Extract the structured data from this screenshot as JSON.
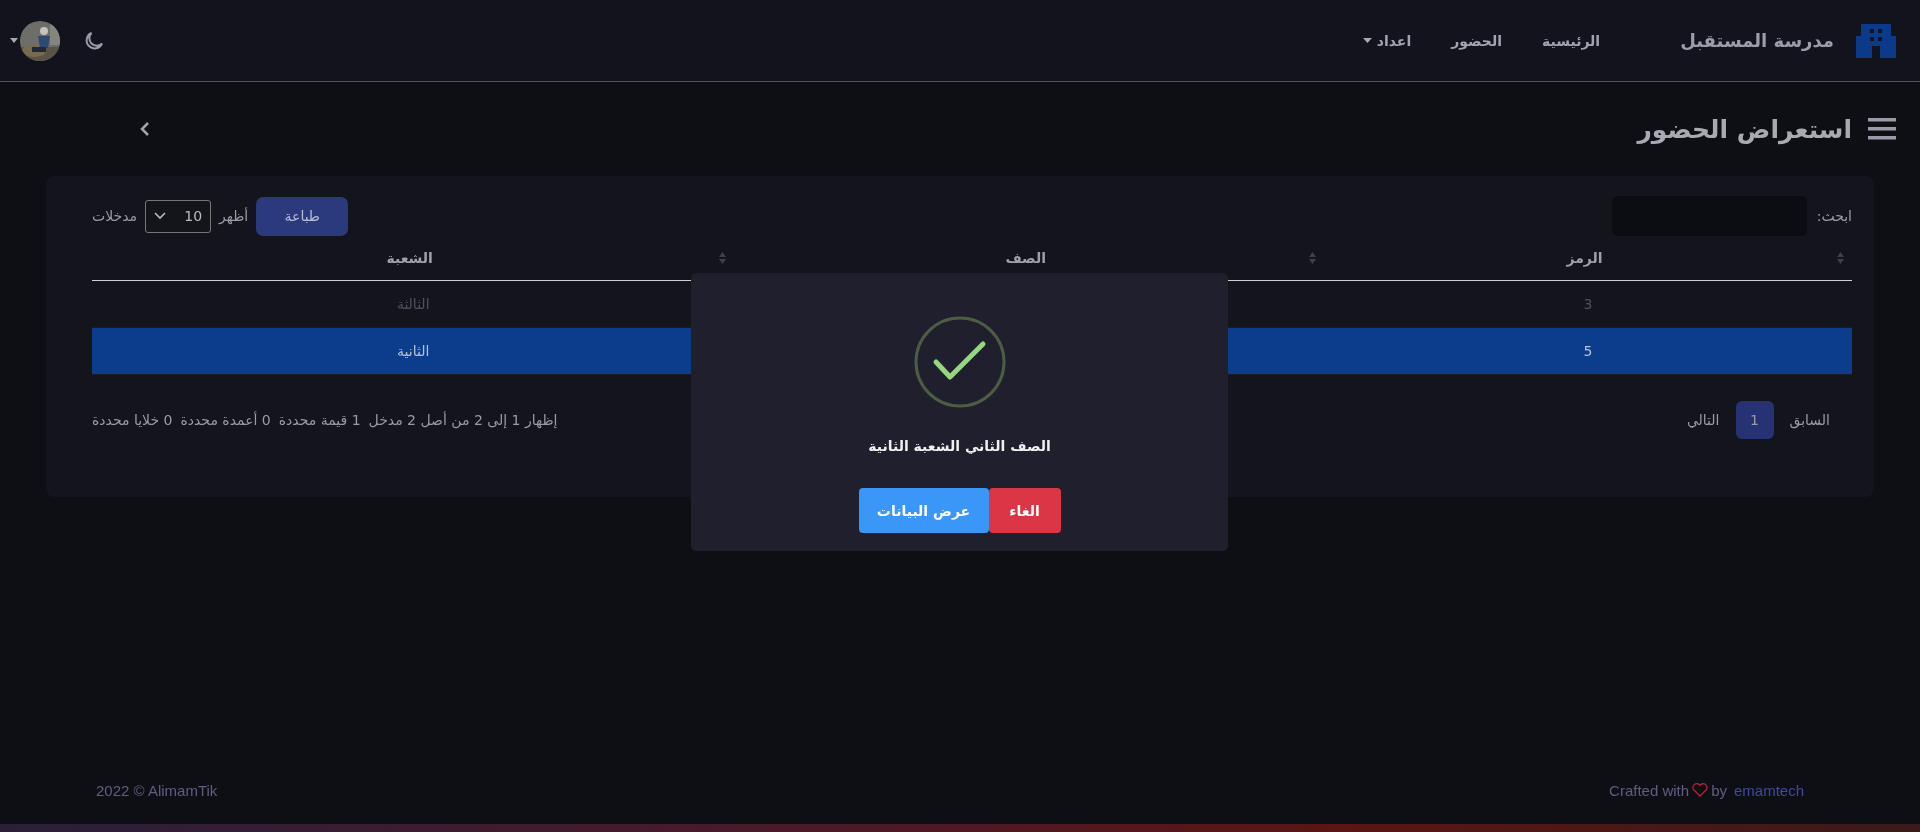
{
  "navbar": {
    "brand": "مدرسة المستقبل",
    "links": [
      {
        "label": "الرئيسية",
        "kind": "link"
      },
      {
        "label": "الحضور",
        "kind": "link"
      },
      {
        "label": "اعداد",
        "kind": "dropdown"
      }
    ]
  },
  "page_title": "استعراض الحضور",
  "table_card": {
    "search_label": "ابحث:",
    "print_button": "طباعة",
    "length_before": "أظهر",
    "length_value": "10",
    "length_after": "مدخلات",
    "columns": [
      "الرمز",
      "الصف",
      "الشعبة"
    ],
    "rows": [
      {
        "code": "3",
        "section": "الثالثة",
        "selected": false
      },
      {
        "code": "5",
        "section": "الثانية",
        "selected": true
      }
    ],
    "info": [
      "إظهار 1 إلى 2 من أصل 2 مدخل",
      "1 قيمة محددة",
      "0 أعمدة محددة",
      "0 خلايا محددة"
    ],
    "pagination": {
      "previous": "السابق",
      "pages": [
        {
          "label": "1",
          "selected": true
        }
      ],
      "next": "التالي"
    }
  },
  "modal": {
    "message": "الصف الثاني الشعبة الثانية",
    "confirm": "عرض البيانات",
    "cancel": "الغاء"
  },
  "footer": {
    "copyright": "2022 © AlimamTik",
    "crafted": "Crafted with",
    "by": "by",
    "author": "emamtech"
  }
}
